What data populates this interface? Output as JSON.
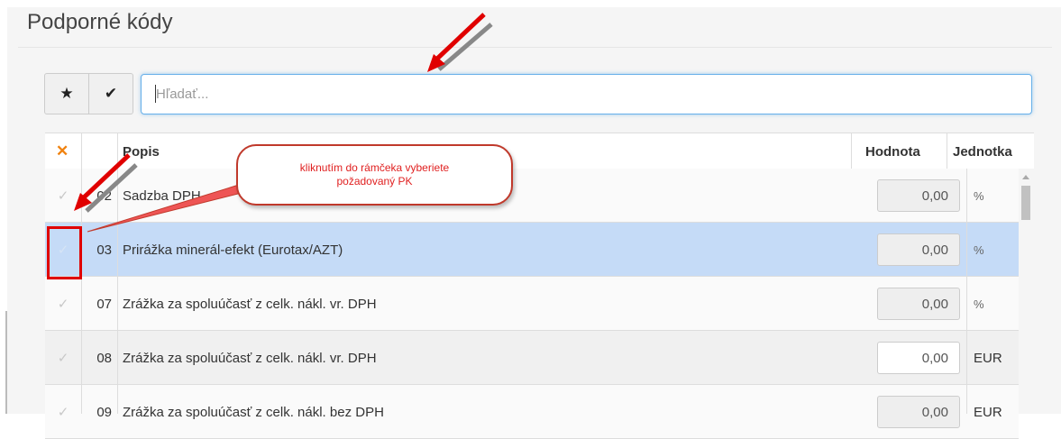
{
  "page_title": "Podporné kódy",
  "toolbar": {
    "star_icon": "★",
    "check_icon": "✔",
    "search_placeholder": "Hľadať..."
  },
  "table": {
    "clear_icon": "✕",
    "headers": {
      "popis": "Popis",
      "hodnota": "Hodnota",
      "jednotka": "Jednotka"
    },
    "rows": [
      {
        "check": "✓",
        "code": "02",
        "desc": "Sadzba DPH",
        "value": "0,00",
        "unit": "%"
      },
      {
        "check": "✓",
        "code": "03",
        "desc": "Prirážka minerál-efekt (Eurotax/AZT)",
        "value": "0,00",
        "unit": "%"
      },
      {
        "check": "✓",
        "code": "07",
        "desc": "Zrážka za spoluúčasť z celk. nákl. vr. DPH",
        "value": "0,00",
        "unit": "%"
      },
      {
        "check": "✓",
        "code": "08",
        "desc": "Zrážka za spoluúčasť z celk. nákl. vr. DPH",
        "value": "0,00",
        "unit": "EUR"
      },
      {
        "check": "✓",
        "code": "09",
        "desc": "Zrážka za spoluúčasť z celk. nákl. bez DPH",
        "value": "0,00",
        "unit": "EUR"
      }
    ]
  },
  "annotation": {
    "callout_line1": "kliknutím do rámčeka vyberiete",
    "callout_line2": "požadovaný PK"
  },
  "colors": {
    "accent_blue": "#66afe9",
    "selected_row": "#c5dbf7",
    "clear_icon": "#f0820f",
    "annotation_red": "#e00000"
  }
}
